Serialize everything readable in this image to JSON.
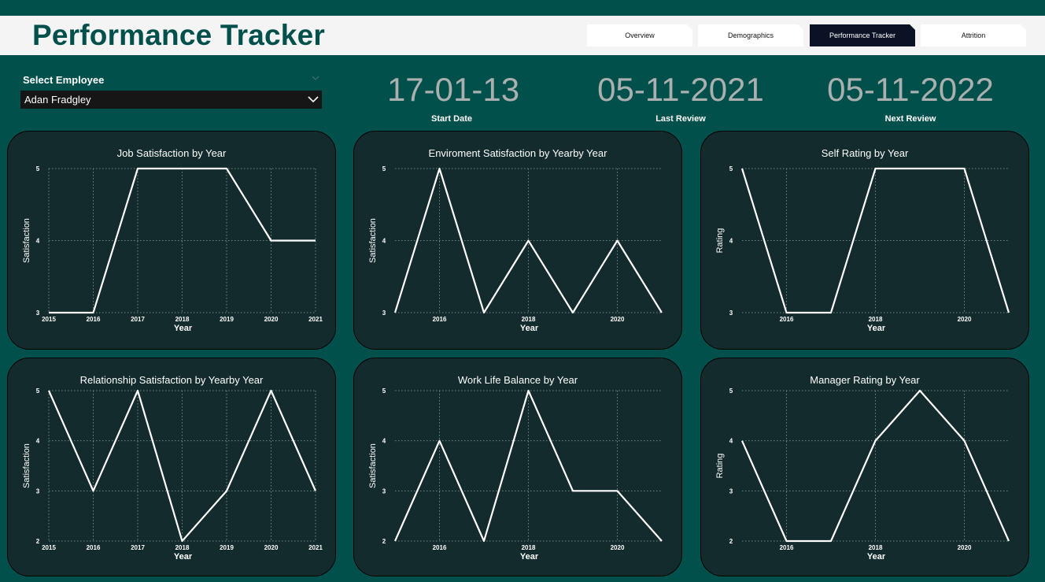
{
  "header": {
    "title": "Performance Tracker"
  },
  "tabs": [
    {
      "label": "Overview",
      "active": false
    },
    {
      "label": "Demographics",
      "active": false
    },
    {
      "label": "Performance Tracker",
      "active": true
    },
    {
      "label": "Attrition",
      "active": false
    }
  ],
  "filter": {
    "label": "Select Employee",
    "value": "Adan Fradgley"
  },
  "kpis": {
    "start": {
      "value": "17-01-13",
      "label": "Start Date"
    },
    "last": {
      "value": "05-11-2021",
      "label": "Last Review"
    },
    "next": {
      "value": "05-11-2022",
      "label": "Next Review"
    }
  },
  "chart_data": [
    {
      "type": "line",
      "title": "Job Satisfaction by Year",
      "xlabel": "Year",
      "ylabel": "Satisfaction",
      "x": [
        2015,
        2016,
        2017,
        2018,
        2019,
        2020,
        2021
      ],
      "values": [
        3,
        3,
        5,
        5,
        5,
        4,
        4
      ],
      "xticks": [
        "2015",
        "2016",
        "2017",
        "2018",
        "2019",
        "2020",
        "2021"
      ],
      "ylim": [
        3,
        5
      ],
      "yticks": [
        3,
        4,
        5
      ]
    },
    {
      "type": "line",
      "title": "Enviroment Satisfaction by Yearby Year",
      "xlabel": "Year",
      "ylabel": "Satisfaction",
      "x": [
        2015,
        2016,
        2017,
        2018,
        2019,
        2020,
        2021
      ],
      "values": [
        3,
        5,
        3,
        4,
        3,
        4,
        3
      ],
      "xticks": [
        "2016",
        "2018",
        "2020"
      ],
      "ylim": [
        3,
        5
      ],
      "yticks": [
        3,
        4,
        5
      ]
    },
    {
      "type": "line",
      "title": "Self Rating by Year",
      "xlabel": "Year",
      "ylabel": "Rating",
      "x": [
        2015,
        2016,
        2017,
        2018,
        2019,
        2020,
        2021
      ],
      "values": [
        5,
        3,
        3,
        5,
        5,
        5,
        3
      ],
      "xticks": [
        "2016",
        "2018",
        "2020"
      ],
      "ylim": [
        3,
        5
      ],
      "yticks": [
        3,
        4,
        5
      ]
    },
    {
      "type": "line",
      "title": "Relationship Satisfaction by Yearby Year",
      "xlabel": "Year",
      "ylabel": "Satisfaction",
      "x": [
        2015,
        2016,
        2017,
        2018,
        2019,
        2020,
        2021
      ],
      "values": [
        5,
        3,
        5,
        2,
        3,
        5,
        3
      ],
      "xticks": [
        "2015",
        "2016",
        "2017",
        "2018",
        "2019",
        "2020",
        "2021"
      ],
      "ylim": [
        2,
        5
      ],
      "yticks": [
        2,
        3,
        4,
        5
      ]
    },
    {
      "type": "line",
      "title": "Work Life Balance by Year",
      "xlabel": "Year",
      "ylabel": "Satisfaction",
      "x": [
        2015,
        2016,
        2017,
        2018,
        2019,
        2020,
        2021
      ],
      "values": [
        2,
        4,
        2,
        5,
        3,
        3,
        2
      ],
      "xticks": [
        "2016",
        "2018",
        "2020"
      ],
      "ylim": [
        2,
        5
      ],
      "yticks": [
        2,
        3,
        4,
        5
      ]
    },
    {
      "type": "line",
      "title": "Manager Rating by Year",
      "xlabel": "Year",
      "ylabel": "Rating",
      "x": [
        2015,
        2016,
        2017,
        2018,
        2019,
        2020,
        2021
      ],
      "values": [
        4,
        2,
        2,
        4,
        5,
        4,
        2
      ],
      "xticks": [
        "2016",
        "2018",
        "2020"
      ],
      "ylim": [
        2,
        5
      ],
      "yticks": [
        2,
        3,
        4,
        5
      ]
    }
  ]
}
